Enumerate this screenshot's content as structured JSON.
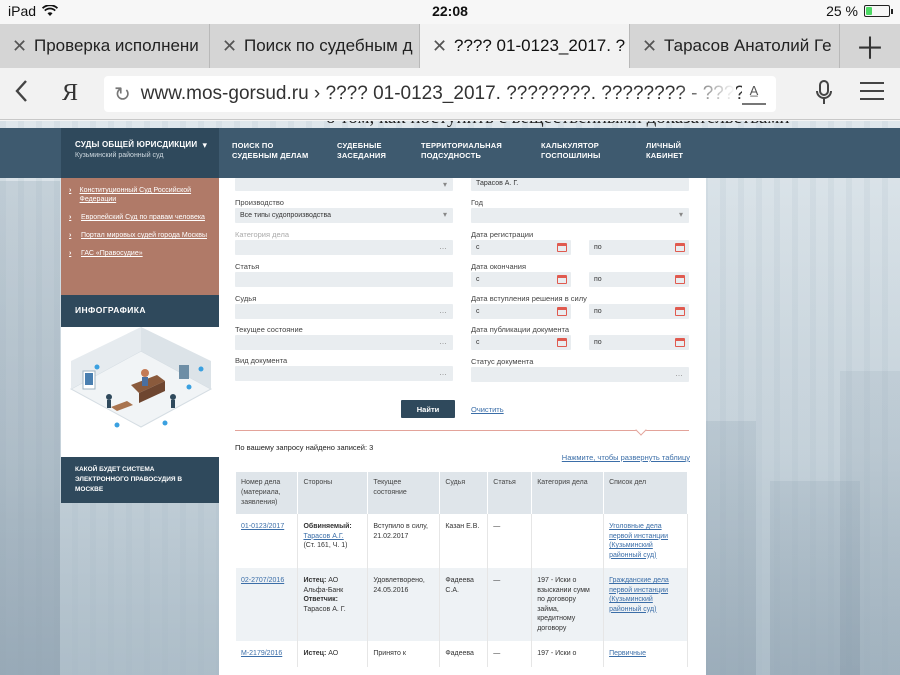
{
  "status_bar": {
    "device": "iPad",
    "time": "22:08",
    "battery": "25 %",
    "battery_level": 0.25
  },
  "tabs": [
    {
      "title": "Проверка исполнени",
      "active": false
    },
    {
      "title": "Поиск по судебным д",
      "active": false
    },
    {
      "title": "???? 01-0123_2017. ??",
      "active": true
    },
    {
      "title": "Тарасов Анатолий Ге",
      "active": false
    }
  ],
  "toolbar": {
    "back_icon": "chevron-left-icon",
    "yandex_label": "Я",
    "url": "www.mos-gorsud.ru › ???? 01-0123_2017. ????????. ???????? - ?????",
    "reader_label": "A̲"
  },
  "page_overflow_text": "о том, как поступить с вещественными доказательствами",
  "nav": {
    "courts_title": "СУДЫ ОБЩЕЙ ЮРИСДИКЦИИ",
    "courts_subtitle": "Кузьминский районный суд",
    "items": [
      "ПОИСК ПО\nСУДЕБНЫМ ДЕЛАМ",
      "СУДЕБНЫЕ\nЗАСЕДАНИЯ",
      "ТЕРРИТОРИАЛЬНАЯ\nПОДСУДНОСТЬ",
      "КАЛЬКУЛЯТОР\nГОСПОШЛИНЫ",
      "ЛИЧНЫЙ\nКАБИНЕТ"
    ]
  },
  "sidebar": {
    "links": [
      "Конституционный Суд Российской Федерации",
      "Европейский Суд по правам человека",
      "Портал мировых судей города Москвы",
      "ГАС «Правосудие»"
    ],
    "infographic_title": "ИНФОГРАФИКА",
    "banner": "КАКОЙ БУДЕТ СИСТЕМА ЭЛЕКТРОННОГО ПРАВОСУДИЯ В МОСКВЕ"
  },
  "form": {
    "left": [
      {
        "label": "Производство",
        "value": "Все типы судопроизводства",
        "muted": false
      },
      {
        "label": "Категория дела",
        "value": "",
        "muted": true
      },
      {
        "label": "Статья",
        "value": "",
        "muted": false
      },
      {
        "label": "Судья",
        "value": "",
        "muted": false
      },
      {
        "label": "Текущее состояние",
        "value": "",
        "muted": false
      },
      {
        "label": "Вид документа",
        "value": "",
        "muted": false
      }
    ],
    "party_value": "Тарасов  А. Г.",
    "right": {
      "year_label": "Год",
      "reg_date_label": "Дата регистрации",
      "end_date_label": "Дата окончания",
      "effect_date_label": "Дата вступления решения в силу",
      "publish_date_label": "Дата публикации документа",
      "from_placeholder": "с",
      "to_placeholder": "по",
      "status_label": "Статус документа"
    },
    "find_button": "Найти",
    "clear_link": "Очистить"
  },
  "results": {
    "found_text": "По вашему запросу найдено записей: 3",
    "expand_link": "Нажмите, чтобы развернуть таблицу",
    "headers": [
      "Номер дела (материала, заявления)",
      "Стороны",
      "Текущее состояние",
      "Судья",
      "Статья",
      "Категория дела",
      "Список дел"
    ],
    "rows": [
      {
        "number": "01-0123/2017",
        "party_role": "Обвиняемый:",
        "party_name": "Тарасов А.Г.",
        "party_extra": "(Ст. 161, Ч. 1)",
        "state": "Вступило в силу, 21.02.2017",
        "judge": "Казан Е.В.",
        "article": "—",
        "category": "",
        "list": "Уголовные дела первой инстанции (Кузьминский районный суд)"
      },
      {
        "number": "02-2707/2016",
        "party_role": "Истец:",
        "party_name": "АО Альфа-Банк",
        "party_role2": "Ответчик:",
        "party_name2": "Тарасов А. Г.",
        "state": "Удовлетворено, 24.05.2016",
        "judge": "Фадеева С.А.",
        "article": "—",
        "category": "197 - Иски о взыскании сумм по договору займа, кредитному договору",
        "list": "Гражданские дела первой инстанции (Кузьминский районный суд)"
      },
      {
        "number": "М-2179/2016",
        "party_role": "Истец:",
        "party_name": "АО",
        "state": "Принято к",
        "judge": "Фадеева",
        "article": "—",
        "category": "197 - Иски о",
        "list": "Первичные"
      }
    ]
  },
  "colors": {
    "nav_dark": "#3e5a6f",
    "nav_darker": "#2f495c",
    "sidebar_brown": "#b07a68",
    "link_blue": "#3b6ea8",
    "accent_red": "#e05a4f"
  }
}
